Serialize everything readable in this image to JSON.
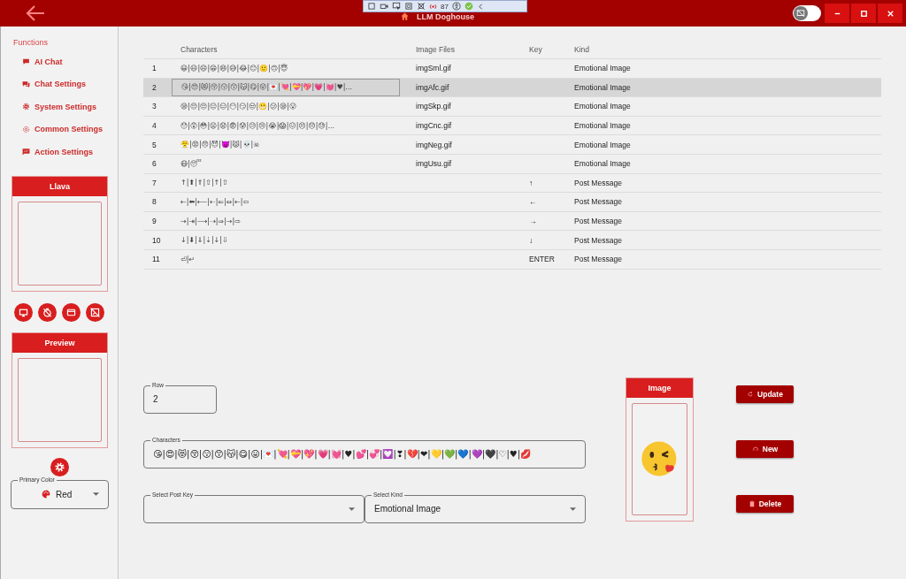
{
  "window": {
    "title": "LLM Doghouse",
    "dark_mode_toggle": {
      "on": false
    }
  },
  "debug_toolbar": {
    "fps": "87"
  },
  "sidebar": {
    "heading": "Functions",
    "items": [
      {
        "label": "AI Chat"
      },
      {
        "label": "Chat Settings"
      },
      {
        "label": "System Settings"
      },
      {
        "label": "Common Settings"
      },
      {
        "label": "Action Settings"
      }
    ],
    "llava": {
      "title": "Llava"
    },
    "preview": {
      "title": "Preview"
    },
    "primary_color": {
      "label": "Primary Color",
      "value": "Red",
      "color": "#d81e1e"
    }
  },
  "table": {
    "columns": [
      "Characters",
      "Image Files",
      "Key",
      "Kind"
    ],
    "rows": [
      {
        "no": "1",
        "chars": "😀|😃|😄|😁|😆|😅|😂|😊|🙂|🙃|😇",
        "image_file": "imgSml.gif",
        "kind_label": "Emotional Image",
        "selected": false
      },
      {
        "no": "2",
        "chars": "😘|😍|😻|😚|😗|😙|😽|😋|😛|💌|💘|💝|💖|💗|💓|♥|...",
        "image_file": "imgAfc.gif",
        "kind_label": "Emotional Image",
        "selected": true
      },
      {
        "no": "3",
        "chars": "😪|😌|😔|😐|😑|😶|😏|😒|😬|😕|😪|😮",
        "image_file": "imgSkp.gif",
        "kind_label": "Emotional Image",
        "selected": false
      },
      {
        "no": "4",
        "chars": "😯|😲|😳|😦|😧|😨|😰|😥|😢|😭|😱|😖|😣|😞|😓|...",
        "image_file": "imgCnc.gif",
        "kind_label": "Emotional Image",
        "selected": false
      },
      {
        "no": "5",
        "chars": "😤|😡|😠|😈|👿|😾|💀|☠",
        "image_file": "imgNeg.gif",
        "kind_label": "Emotional Image",
        "selected": false
      },
      {
        "no": "6",
        "chars": "😷|😴",
        "image_file": "imgUsu.gif",
        "kind_label": "Emotional Image",
        "selected": false
      },
      {
        "no": "7",
        "chars": "↑|⬆|⇑|⇧|↑|⇧",
        "key": "↑",
        "kind_label": "Post Message",
        "selected": false
      },
      {
        "no": "8",
        "chars": "←|⬅|⟵|⇠|⇐|⇔|←|⇦",
        "key": "←",
        "kind_label": "Post Message",
        "selected": false
      },
      {
        "no": "9",
        "chars": "→|⇥|⟶|⇢|⇒|→|⇨",
        "key": "→",
        "kind_label": "Post Message",
        "selected": false
      },
      {
        "no": "10",
        "chars": "↓|⬇|⇓|⇣|↓|⇩",
        "key": "↓",
        "kind_label": "Post Message",
        "selected": false
      },
      {
        "no": "11",
        "chars": "⏎|↵",
        "key": "ENTER",
        "kind_label": "Post Message",
        "selected": false
      }
    ]
  },
  "form": {
    "row": {
      "label": "Row",
      "value": "2"
    },
    "characters": {
      "label": "Characters",
      "value": "😘|😍|😻|😚|😗|😙|😽|😋|😛|💌|💘|💝|💖|💗|💓|♥|💕|💞|💟|❣|💔|❤|💛|💚|💙|💜|🖤|♡|♥|💋"
    },
    "post_key": {
      "label": "Select Post Key"
    },
    "kind": {
      "label": "Select Kind",
      "value": "Emotional Image"
    },
    "image": {
      "title": "Image"
    },
    "buttons": [
      {
        "label": "Update"
      },
      {
        "label": "New"
      },
      {
        "label": "Delete"
      }
    ]
  }
}
